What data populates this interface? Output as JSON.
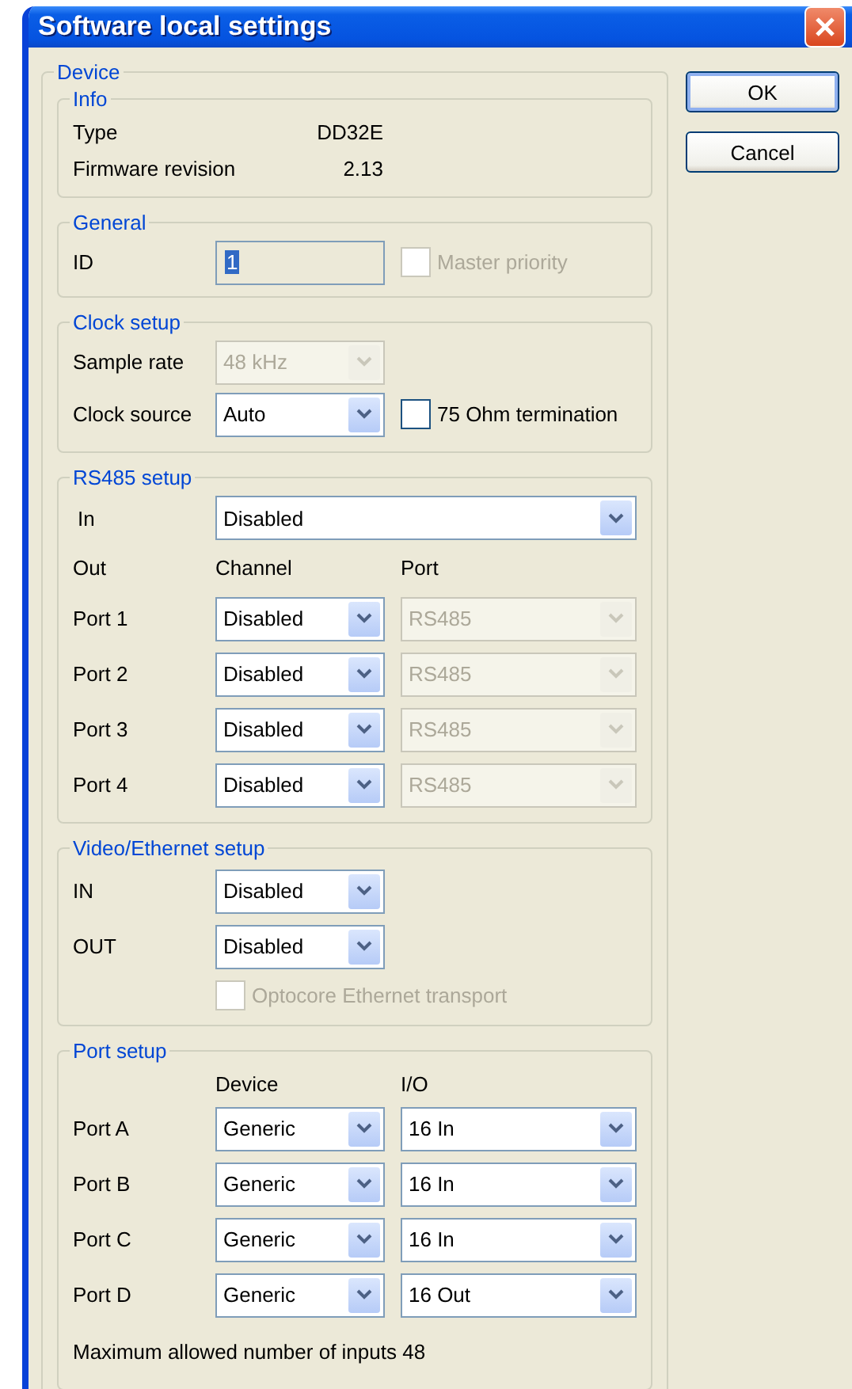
{
  "window": {
    "title": "Software local settings"
  },
  "buttons": [
    {
      "label": "OK",
      "default": true
    },
    {
      "label": "Cancel",
      "default": false
    }
  ],
  "device": {
    "legend": "Device",
    "info": {
      "legend": "Info",
      "rows": [
        {
          "label": "Type",
          "value": "DD32E"
        },
        {
          "label": "Firmware revision",
          "value": "2.13"
        }
      ]
    },
    "general": {
      "legend": "General",
      "id": {
        "label": "ID",
        "value": "1",
        "read_only": true,
        "highlighted": true
      },
      "master_priority": {
        "label": "Master priority",
        "checked": false,
        "disabled": true
      }
    },
    "clock_setup": {
      "legend": "Clock setup",
      "sample_rate": {
        "label": "Sample rate",
        "value": "48 kHz",
        "disabled": true
      },
      "clock_source": {
        "label": "Clock source",
        "value": "Auto",
        "disabled": false
      },
      "termination": {
        "label": "75 Ohm termination",
        "checked": false,
        "disabled": false
      }
    },
    "rs485_setup": {
      "legend": "RS485 setup",
      "in": {
        "label": "In",
        "value": "Disabled",
        "disabled": false
      },
      "headers": [
        "Out",
        "Channel",
        "Port"
      ],
      "ports": [
        {
          "label": "Port 1",
          "channel": {
            "value": "Disabled",
            "disabled": false
          },
          "port": {
            "value": "RS485",
            "disabled": true
          }
        },
        {
          "label": "Port 2",
          "channel": {
            "value": "Disabled",
            "disabled": false
          },
          "port": {
            "value": "RS485",
            "disabled": true
          }
        },
        {
          "label": "Port 3",
          "channel": {
            "value": "Disabled",
            "disabled": false
          },
          "port": {
            "value": "RS485",
            "disabled": true
          }
        },
        {
          "label": "Port 4",
          "channel": {
            "value": "Disabled",
            "disabled": false
          },
          "port": {
            "value": "RS485",
            "disabled": true
          }
        }
      ]
    },
    "video_ethernet_setup": {
      "legend": "Video/Ethernet setup",
      "rows": [
        {
          "label": "IN",
          "value": "Disabled",
          "disabled": false
        },
        {
          "label": "OUT",
          "value": "Disabled",
          "disabled": false
        }
      ],
      "transport": {
        "label": "Optocore Ethernet transport",
        "checked": false,
        "disabled": true
      }
    },
    "port_setup": {
      "legend": "Port setup",
      "headers": [
        "Device",
        "I/O"
      ],
      "ports": [
        {
          "label": "Port A",
          "device": {
            "value": "Generic",
            "disabled": false
          },
          "io": {
            "value": "16 In",
            "disabled": false
          }
        },
        {
          "label": "Port B",
          "device": {
            "value": "Generic",
            "disabled": false
          },
          "io": {
            "value": "16 In",
            "disabled": false
          }
        },
        {
          "label": "Port C",
          "device": {
            "value": "Generic",
            "disabled": false
          },
          "io": {
            "value": "16 In",
            "disabled": false
          }
        },
        {
          "label": "Port D",
          "device": {
            "value": "Generic",
            "disabled": false
          },
          "io": {
            "value": "16 Out",
            "disabled": false
          }
        }
      ],
      "note": "Maximum allowed number of inputs 48"
    }
  }
}
